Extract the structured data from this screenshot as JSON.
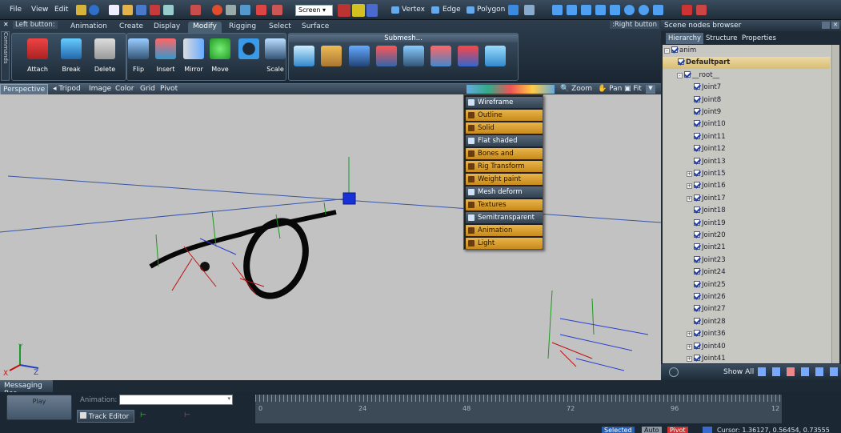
{
  "colors": {
    "accent": "#e0a93c",
    "menu_dark": "#3d4e60",
    "viewport": "#c2c2c2",
    "tree_bg": "#c8c8c2",
    "selected": "#2a5fb0"
  },
  "menubar": {
    "items": [
      "File",
      "View",
      "Edit"
    ],
    "screen_dropdown": "Screen",
    "vertex": "Vertex",
    "edge": "Edge",
    "polygon": "Polygon"
  },
  "ribbon": {
    "left_button": "Left button:",
    "right_button": ":Right button",
    "tabs": [
      "Animation",
      "Create",
      "Display",
      "Modify",
      "Rigging",
      "Select",
      "Surface"
    ],
    "active_tab": "Modify",
    "side_label": "Commands",
    "buttons": [
      "Attach",
      "Break",
      "Delete",
      "Flip",
      "Insert",
      "Mirror",
      "Move",
      "Scale"
    ],
    "submesh_title": "Submesh..."
  },
  "viewport_bar": {
    "perspective": "Perspective",
    "tripod": "Tripod",
    "image": "Image",
    "color": "Color",
    "grid": "Grid",
    "pivot": "Pivot",
    "zoom": "Zoom",
    "pan": "Pan",
    "fit": "Fit"
  },
  "shade_menu": [
    {
      "label": "Wireframe",
      "style": "dark",
      "icon": "wireframe-icon"
    },
    {
      "label": "Outline",
      "style": "gold",
      "icon": "outline-icon"
    },
    {
      "label": "Solid",
      "style": "gold",
      "icon": "solid-icon"
    },
    {
      "label": "Flat shaded",
      "style": "dark",
      "icon": "flat-shaded-icon"
    },
    {
      "label": "Bones and Skeleton",
      "style": "gold",
      "icon": "bones-icon"
    },
    {
      "label": "Rig Transform",
      "style": "gold",
      "icon": "rig-transform-icon"
    },
    {
      "label": "Weight paint",
      "style": "gold",
      "icon": "weight-paint-icon"
    },
    {
      "label": "Mesh deform",
      "style": "dark",
      "icon": "mesh-deform-icon"
    },
    {
      "label": "Textures",
      "style": "gold",
      "icon": "textures-icon"
    },
    {
      "label": "Semitransparent",
      "style": "dark",
      "icon": "semitransparent-icon"
    },
    {
      "label": "Animation",
      "style": "gold",
      "icon": "animation-icon"
    },
    {
      "label": "Light",
      "style": "gold",
      "icon": "light-icon"
    }
  ],
  "right_panel": {
    "title": "Scene nodes browser",
    "tabs": [
      "Hierarchy",
      "Structure",
      "Properties"
    ],
    "active_tab": "Hierarchy",
    "show_all": "Show All"
  },
  "tree": [
    {
      "label": "anim",
      "level": 0,
      "expander": "-"
    },
    {
      "label": "Defaultpart",
      "level": 1,
      "expander": "",
      "bold": true,
      "selected": true
    },
    {
      "label": "__root__",
      "level": 2,
      "expander": "-"
    },
    {
      "label": "Joint7",
      "level": 3,
      "expander": ""
    },
    {
      "label": "Joint8",
      "level": 3,
      "expander": ""
    },
    {
      "label": "Joint9",
      "level": 3,
      "expander": ""
    },
    {
      "label": "Joint10",
      "level": 3,
      "expander": ""
    },
    {
      "label": "Joint11",
      "level": 3,
      "expander": ""
    },
    {
      "label": "Joint12",
      "level": 3,
      "expander": ""
    },
    {
      "label": "Joint13",
      "level": 3,
      "expander": ""
    },
    {
      "label": "Joint15",
      "level": 3,
      "expander": "+"
    },
    {
      "label": "Joint16",
      "level": 3,
      "expander": "+"
    },
    {
      "label": "Joint17",
      "level": 3,
      "expander": "+"
    },
    {
      "label": "Joint18",
      "level": 3,
      "expander": ""
    },
    {
      "label": "Joint19",
      "level": 3,
      "expander": ""
    },
    {
      "label": "Joint20",
      "level": 3,
      "expander": ""
    },
    {
      "label": "Joint21",
      "level": 3,
      "expander": ""
    },
    {
      "label": "Joint23",
      "level": 3,
      "expander": ""
    },
    {
      "label": "Joint24",
      "level": 3,
      "expander": ""
    },
    {
      "label": "Joint25",
      "level": 3,
      "expander": ""
    },
    {
      "label": "Joint26",
      "level": 3,
      "expander": ""
    },
    {
      "label": "Joint27",
      "level": 3,
      "expander": ""
    },
    {
      "label": "Joint28",
      "level": 3,
      "expander": ""
    },
    {
      "label": "Joint36",
      "level": 3,
      "expander": "+"
    },
    {
      "label": "Joint40",
      "level": 3,
      "expander": "+"
    },
    {
      "label": "Joint41",
      "level": 3,
      "expander": "+"
    }
  ],
  "messaging": {
    "tab": "Messaging Bar",
    "play": "Play",
    "animation_label": "Animation:",
    "track_editor": "Track Editor"
  },
  "timeline": {
    "ticks": [
      "0",
      "24",
      "48",
      "72",
      "96",
      "12"
    ]
  },
  "status": {
    "selected": "Selected",
    "auto": "Auto",
    "pivot": "Pivot",
    "cursor": "Cursor: 1.36127, 0.56454, 0.73555"
  },
  "axes": {
    "y": "Y",
    "z": "Z",
    "x": "X"
  }
}
